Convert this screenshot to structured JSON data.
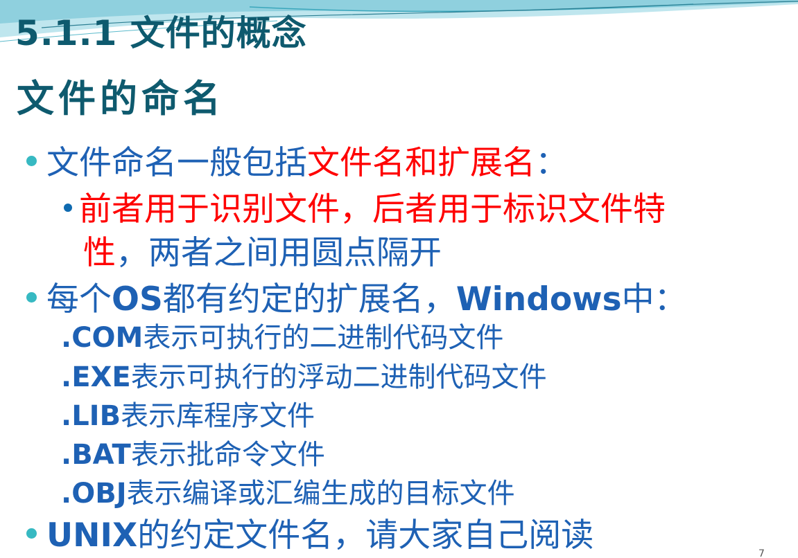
{
  "slide": {
    "title": "5.1.1 文件的概念",
    "subtitle": "文件的命名",
    "bullet1": {
      "text_a": "文件命名一般包括",
      "text_b": "文件名和扩展名",
      "text_c": "："
    },
    "bullet1_sub": {
      "line1": "前者用于识别文件，后者用于标识文件特",
      "line2_a": "性",
      "line2_b": "，两者之间用圆点隔开"
    },
    "bullet2": {
      "text_a": "每个",
      "text_b": "OS",
      "text_c": "都有约定的扩展名，",
      "text_d": "Windows",
      "text_e": "中："
    },
    "extensions": [
      {
        "ext": ".COM",
        "desc": "表示可执行的二进制代码文件"
      },
      {
        "ext": ".EXE",
        "desc": "表示可执行的浮动二进制代码文件"
      },
      {
        "ext": ".LIB",
        "desc": "表示库程序文件"
      },
      {
        "ext": ".BAT",
        "desc": "表示批命令文件"
      },
      {
        "ext": ".OBJ",
        "desc": "表示编译或汇编生成的目标文件"
      }
    ],
    "bullet3": {
      "text_a": "UNIX",
      "text_b": "的约定文件名，请大家自己阅读"
    },
    "page_number": "7"
  },
  "colors": {
    "title": "#0e5a6e",
    "body": "#1e61b4",
    "highlight": "#ff0000",
    "bullet": "#37b9c2"
  }
}
